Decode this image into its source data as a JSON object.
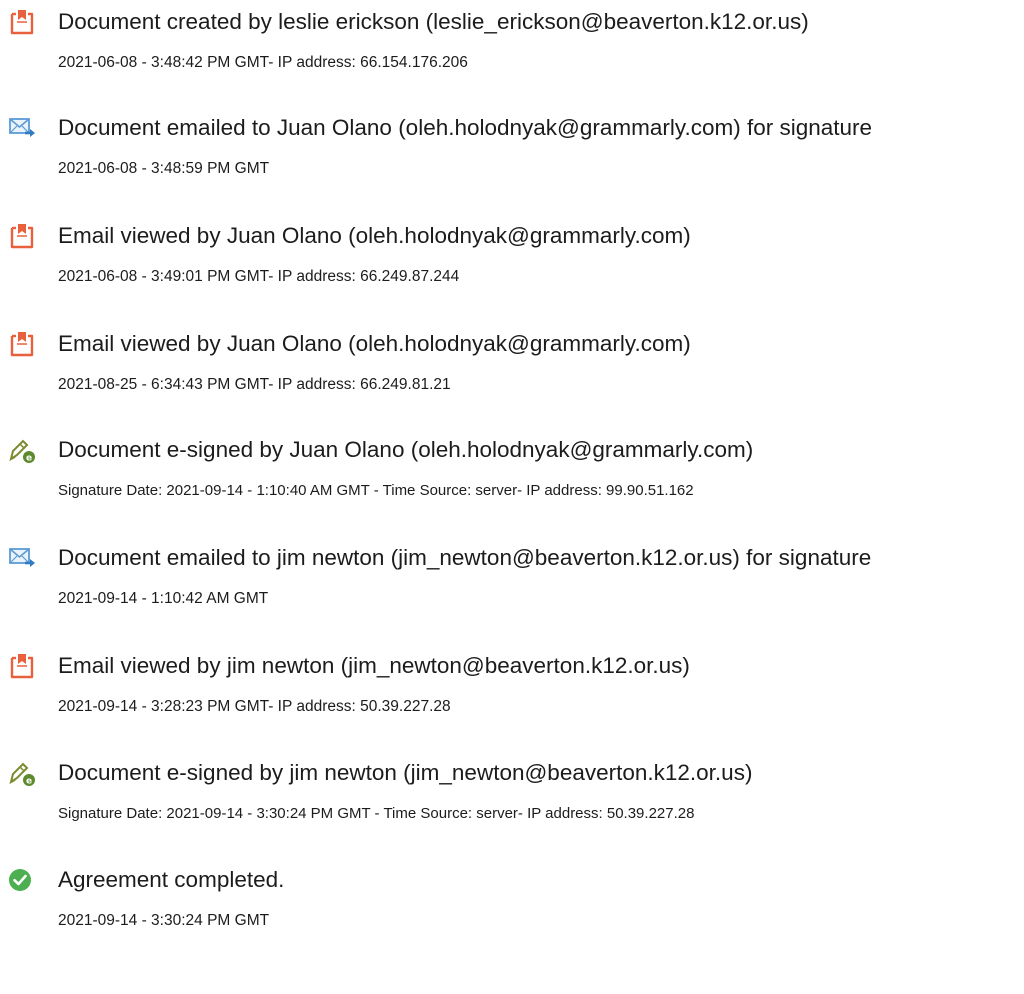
{
  "events": [
    {
      "icon": "document-created-icon",
      "title": "Document created by leslie erickson (leslie_erickson@beaverton.k12.or.us)",
      "detail": "2021-06-08 - 3:48:42 PM GMT- IP address: 66.154.176.206"
    },
    {
      "icon": "email-sent-icon",
      "title": "Document emailed to Juan Olano (oleh.holodnyak@grammarly.com) for signature",
      "detail": "2021-06-08 - 3:48:59 PM GMT"
    },
    {
      "icon": "document-viewed-icon",
      "title": "Email viewed by Juan Olano (oleh.holodnyak@grammarly.com)",
      "detail": "2021-06-08 - 3:49:01 PM GMT- IP address: 66.249.87.244"
    },
    {
      "icon": "document-viewed-icon",
      "title": "Email viewed by Juan Olano (oleh.holodnyak@grammarly.com)",
      "detail": "2021-08-25 - 6:34:43 PM GMT- IP address: 66.249.81.21"
    },
    {
      "icon": "e-sign-pen-icon",
      "title": "Document e-signed by Juan Olano (oleh.holodnyak@grammarly.com)",
      "detail": "Signature Date: 2021-09-14 - 1:10:40 AM GMT - Time Source: server- IP address: 99.90.51.162"
    },
    {
      "icon": "email-sent-icon",
      "title": "Document emailed to jim newton (jim_newton@beaverton.k12.or.us) for signature",
      "detail": "2021-09-14 - 1:10:42 AM GMT"
    },
    {
      "icon": "document-viewed-icon",
      "title": "Email viewed by jim newton (jim_newton@beaverton.k12.or.us)",
      "detail": "2021-09-14 - 3:28:23 PM GMT- IP address: 50.39.227.28"
    },
    {
      "icon": "e-sign-pen-icon",
      "title": "Document e-signed by jim newton (jim_newton@beaverton.k12.or.us)",
      "detail": "Signature Date: 2021-09-14 - 3:30:24 PM GMT - Time Source: server- IP address: 50.39.227.28"
    },
    {
      "icon": "check-circle-icon",
      "title": "Agreement completed.",
      "detail": "2021-09-14 - 3:30:24 PM GMT"
    }
  ],
  "colors": {
    "document_icon": "#E8613C",
    "email_icon": "#5B9BD5",
    "email_arrow": "#2F7BC4",
    "pen_icon": "#7A8C2E",
    "check_icon": "#4CAF50",
    "text": "#1C1C1C"
  }
}
